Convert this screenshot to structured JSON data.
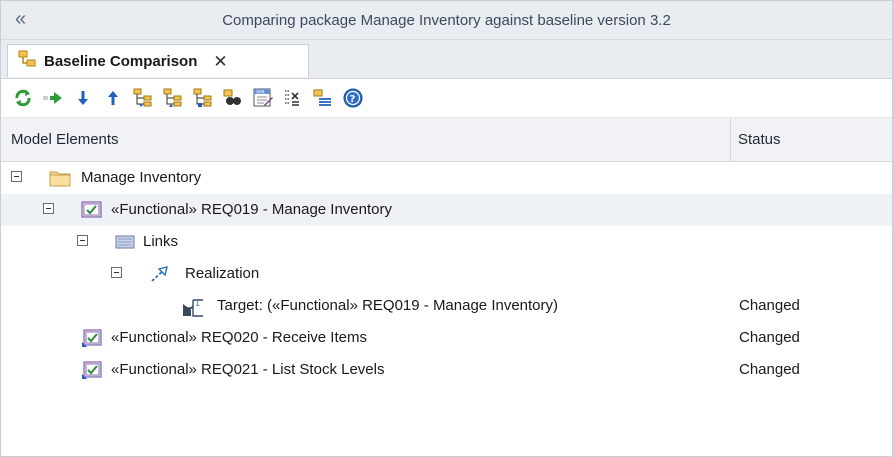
{
  "window": {
    "title": "Comparing package Manage Inventory against baseline version 3.2",
    "collapse_icon": "double-chevron-left-icon"
  },
  "tab": {
    "label": "Baseline Comparison",
    "close_glyph": "✕"
  },
  "toolbar": {
    "buttons": [
      "refresh-icon",
      "merge-icon",
      "next-change-icon",
      "previous-change-icon",
      "expand-all-icon",
      "collapse-all-icon",
      "show-differences-icon",
      "find-icon",
      "xml-report-icon",
      "filter-options-icon",
      "log-icon",
      "help-icon"
    ]
  },
  "grid": {
    "columns": [
      "Model Elements",
      "Status"
    ],
    "rows": [
      {
        "label": "Manage Inventory",
        "status": "",
        "icon": "folder-icon",
        "expander": true
      },
      {
        "label": "«Functional» REQ019 - Manage Inventory",
        "status": "",
        "icon": "requirement-icon",
        "expander": true
      },
      {
        "label": "Links",
        "status": "",
        "icon": "links-icon",
        "expander": true
      },
      {
        "label": "Realization",
        "status": "",
        "icon": "realization-icon",
        "expander": true
      },
      {
        "label": "Target: («Functional» REQ019 - Manage Inventory)",
        "status": "Changed",
        "icon": "target-icon",
        "expander": false
      },
      {
        "label": "«Functional» REQ020 - Receive Items",
        "status": "Changed",
        "icon": "requirement-changed-icon",
        "expander": false
      },
      {
        "label": "«Functional» REQ021 - List Stock Levels",
        "status": "Changed",
        "icon": "requirement-changed-icon",
        "expander": false
      }
    ]
  },
  "colors": {
    "accent_blue": "#2e6fc4",
    "header_bg": "#e9ecf1",
    "selected_row": "#eef1f5"
  }
}
